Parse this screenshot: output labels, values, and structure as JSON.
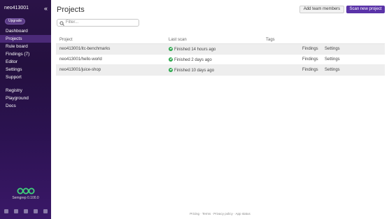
{
  "sidebar": {
    "username": "neo413001",
    "collapse_icon": "chevrons-left-icon",
    "upgrade_label": "Upgrade",
    "nav": [
      {
        "label": "Dashboard",
        "active": false
      },
      {
        "label": "Projects",
        "active": true
      },
      {
        "label": "Rule board",
        "active": false
      },
      {
        "label": "Findings (7)",
        "active": false
      },
      {
        "label": "Editor",
        "active": false
      },
      {
        "label": "Settings",
        "active": false
      },
      {
        "label": "Support",
        "active": false
      }
    ],
    "nav2": [
      {
        "label": "Registry"
      },
      {
        "label": "Playground"
      },
      {
        "label": "Docs"
      }
    ],
    "logo": "semgrep-logo",
    "version": "Semgrep 0.100.0",
    "footer_icons": [
      "document-icon",
      "slack-icon",
      "github-icon",
      "twitter-icon",
      "calendar-icon"
    ]
  },
  "main": {
    "title": "Projects",
    "add_team_label": "Add team members",
    "scan_new_label": "Scan new project",
    "filter_placeholder": "Filter...",
    "columns": [
      "Project",
      "Last scan",
      "Tags"
    ],
    "rows": [
      {
        "project": "neo413001/itc-benchmarks",
        "scan": "Finished 14 hours ago",
        "findings": "Findings",
        "settings": "Settings"
      },
      {
        "project": "neo413001/hello-world",
        "scan": "Finished 2 days ago",
        "findings": "Findings",
        "settings": "Settings"
      },
      {
        "project": "neo413001/juice-shop",
        "scan": "Finished 10 days ago",
        "findings": "Findings",
        "settings": "Settings"
      }
    ],
    "footer": "Pricing · Terms · Privacy policy · App status"
  },
  "colors": {
    "sidebar_bg": "#2a1347",
    "accent": "#5a33a8",
    "success": "#2fa84f"
  }
}
